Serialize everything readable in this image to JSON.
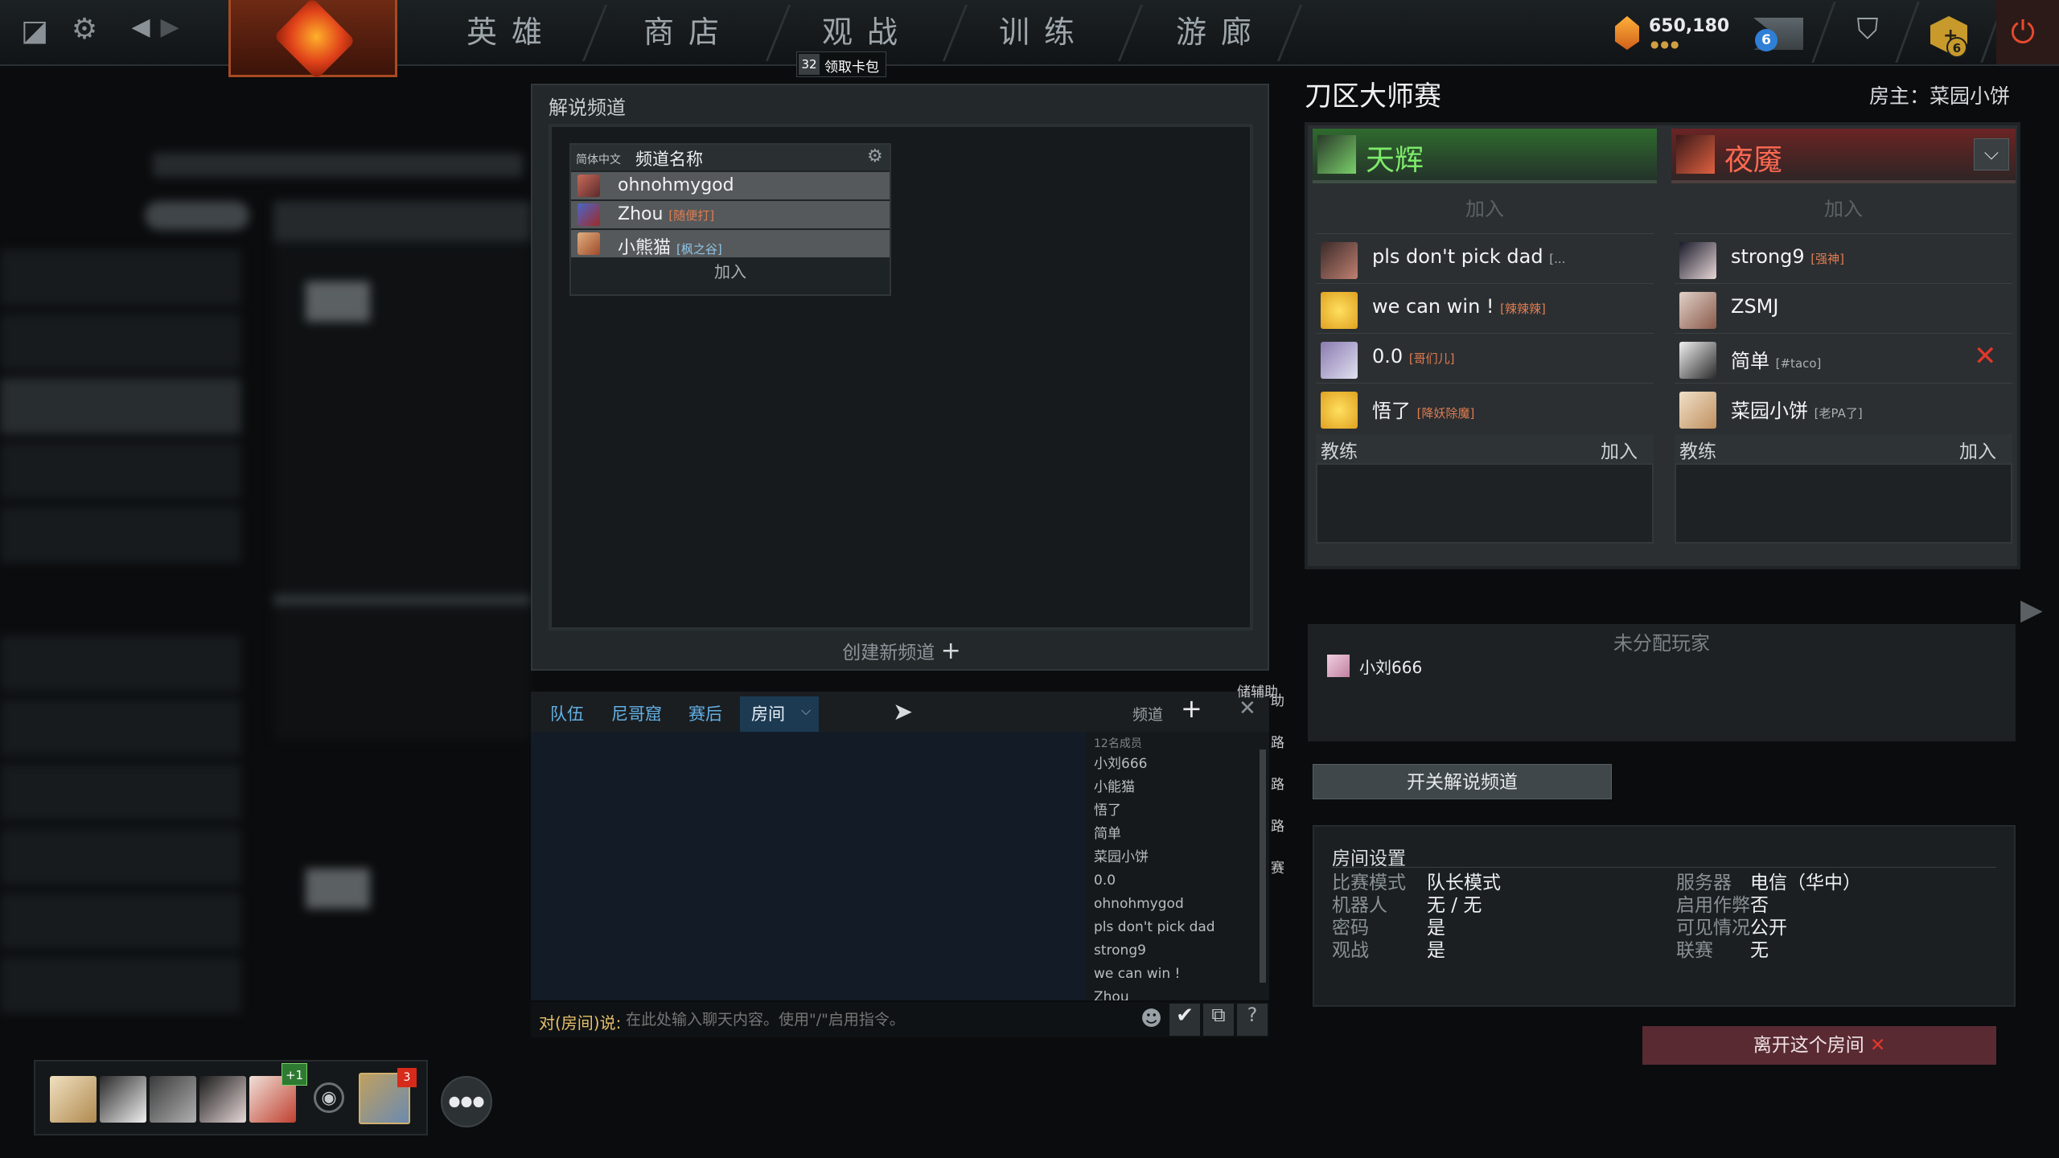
{
  "nav": {
    "heroes": "英雄",
    "store": "商店",
    "watch": "观战",
    "learn": "训练",
    "arcade": "游廊"
  },
  "currency": {
    "shards": "650,180"
  },
  "badges": {
    "mail": "6",
    "plus": "6",
    "party_notice": "3",
    "party_extra": "+1"
  },
  "tooltip": {
    "count": "32",
    "text": "领取卡包"
  },
  "spectator": {
    "title": "解说频道",
    "language": "简体中文",
    "name_header": "频道名称",
    "members": [
      {
        "name": "ohnohmygod",
        "tag": ""
      },
      {
        "name": "Zhou",
        "tag": "[随便打]"
      },
      {
        "name": "小熊猫",
        "tag": "[枫之谷]"
      }
    ],
    "join": "加入",
    "create": "创建新频道"
  },
  "chat": {
    "tabs": [
      "队伍",
      "尼哥窟",
      "赛后",
      "房间"
    ],
    "channels": "频道",
    "member_count": "12名成员",
    "members": [
      "小刘666",
      "小能猫",
      "悟了",
      "简单",
      "菜园小饼",
      "0.0",
      "ohnohmygod",
      "pls don't pick dad",
      "strong9",
      "we can win !",
      "Zhou"
    ],
    "prompt": "对(房间)说:",
    "placeholder": "在此处输入聊天内容。使用\"/\"启用指令。",
    "side_labels": [
      "储辅助",
      "助",
      "路",
      "路",
      "路",
      "赛"
    ]
  },
  "lobby": {
    "title": "刀区大师赛",
    "host": "房主：菜园小饼",
    "radiant": {
      "name": "天辉",
      "join": "加入",
      "players": [
        {
          "name": "pls don't pick dad",
          "tag": "[..."
        },
        {
          "name": "we can win !",
          "tag": "[辣辣辣]"
        },
        {
          "name": "0.0",
          "tag": "[哥们儿]"
        },
        {
          "name": "悟了",
          "tag": "[降妖除魔]"
        }
      ],
      "coach": "教练",
      "coach_join": "加入"
    },
    "dire": {
      "name": "夜魇",
      "join": "加入",
      "players": [
        {
          "name": "strong9",
          "tag": "[强神]"
        },
        {
          "name": "ZSMJ",
          "tag": ""
        },
        {
          "name": "简单",
          "tag": "[#taco]"
        },
        {
          "name": "菜园小饼",
          "tag": "[老PA了]"
        }
      ],
      "coach": "教练",
      "coach_join": "加入"
    },
    "unassigned_title": "未分配玩家",
    "unassigned": [
      "小刘666"
    ],
    "toggle_btn": "开关解说频道",
    "settings_title": "房间设置",
    "settings_left": [
      {
        "k": "比赛模式",
        "v": "队长模式"
      },
      {
        "k": "机器人",
        "v": "无 / 无"
      },
      {
        "k": "密码",
        "v": "是"
      },
      {
        "k": "观战",
        "v": "是"
      }
    ],
    "settings_right": [
      {
        "k": "服务器",
        "v": "电信（华中）"
      },
      {
        "k": "启用作弊",
        "v": "否"
      },
      {
        "k": "可见情况",
        "v": "公开"
      },
      {
        "k": "联赛",
        "v": "无"
      }
    ],
    "leave_btn": "离开这个房间"
  },
  "colors": {
    "radiant": "#6ad45a",
    "dire": "#e0513f",
    "link": "#63b0e4",
    "tag": "#e07d50"
  }
}
